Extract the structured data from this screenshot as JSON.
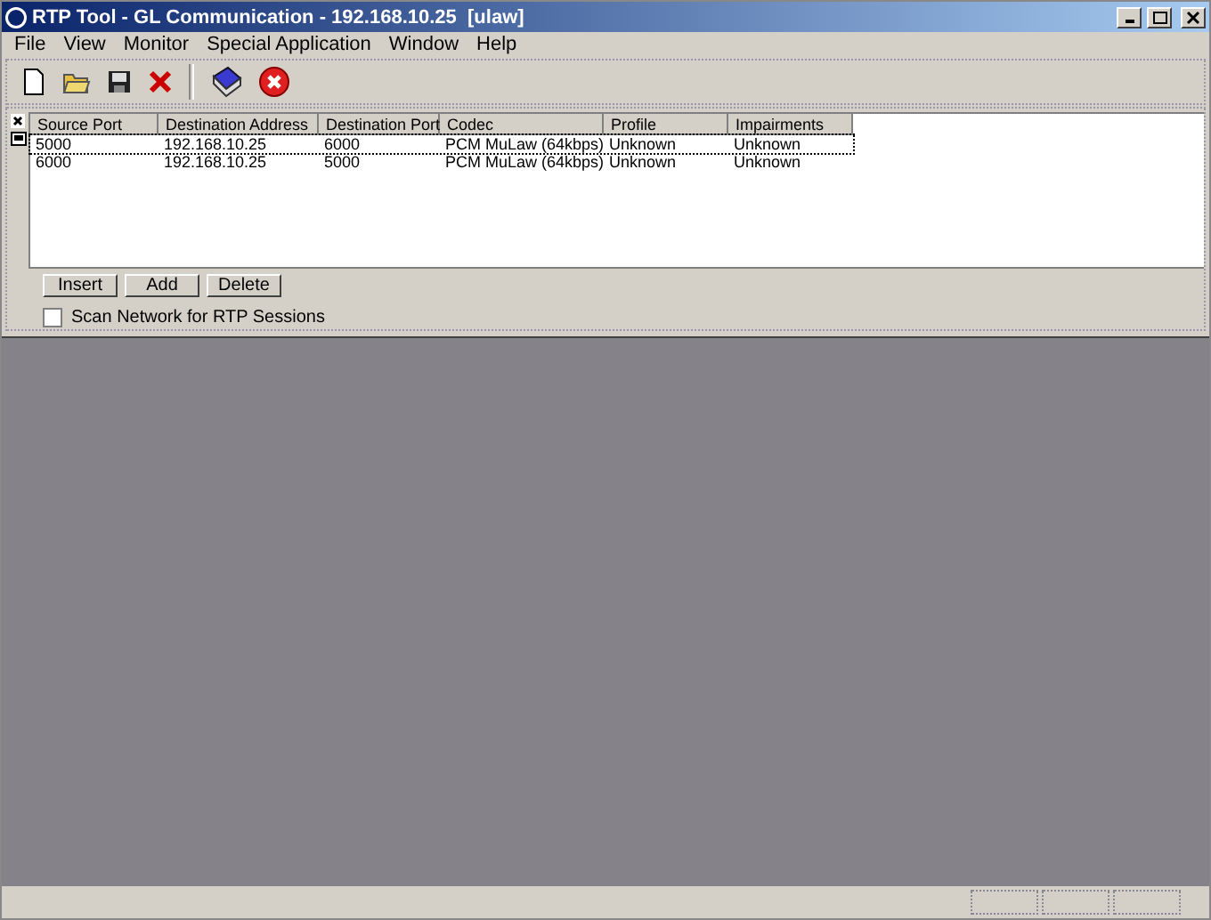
{
  "window": {
    "title": "RTP Tool - GL Communication - 192.168.10.25  [ulaw]"
  },
  "menu": [
    "File",
    "View",
    "Monitor",
    "Special Application",
    "Window",
    "Help"
  ],
  "toolbar": [
    {
      "kind": "new"
    },
    {
      "kind": "open"
    },
    {
      "kind": "save"
    },
    {
      "kind": "delete"
    },
    {
      "kind": "sep"
    },
    {
      "kind": "book"
    },
    {
      "kind": "stop"
    }
  ],
  "table": {
    "columns": [
      "Source Port",
      "Destination Address",
      "Destination Port",
      "Codec",
      "Profile",
      "Impairments"
    ],
    "rows": [
      {
        "selected": true,
        "cells": [
          "5000",
          "192.168.10.25",
          "6000",
          "PCM MuLaw (64kbps)",
          "Unknown",
          "Unknown"
        ]
      },
      {
        "selected": false,
        "cells": [
          "6000",
          "192.168.10.25",
          "5000",
          "PCM MuLaw (64kbps)",
          "Unknown",
          "Unknown"
        ]
      }
    ]
  },
  "buttons": [
    "Insert",
    "Add",
    "Delete"
  ],
  "scan": {
    "label": "Scan Network for RTP Sessions",
    "checked": false
  }
}
